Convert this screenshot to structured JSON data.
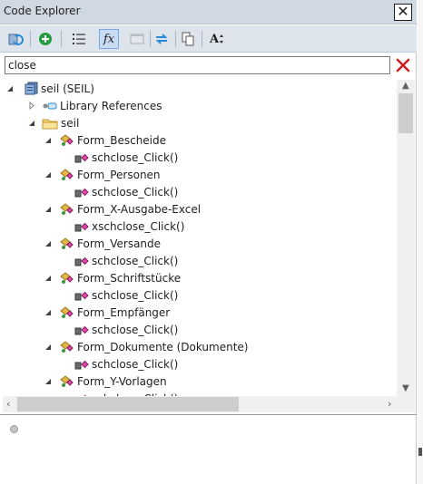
{
  "window": {
    "title": "Code Explorer",
    "close_glyph": "✕"
  },
  "toolbar": {
    "buttons": [
      {
        "name": "refresh-icon"
      },
      {
        "name": "add-icon"
      },
      {
        "name": "numbered-list-icon"
      },
      {
        "name": "function-icon",
        "label": "fx",
        "active": true
      },
      {
        "name": "window-icon",
        "disabled": true
      },
      {
        "name": "sync-icon"
      },
      {
        "name": "copy-icon"
      },
      {
        "name": "sort-icon",
        "label": "A"
      }
    ]
  },
  "search": {
    "value": "close",
    "clear_icon": "clear-search-icon"
  },
  "tree": {
    "root": "seil (SEIL)",
    "library_references": "Library References",
    "folder": "seil",
    "forms": [
      {
        "name": "Form_Bescheide",
        "member": "schclose_Click()"
      },
      {
        "name": "Form_Personen",
        "member": "schclose_Click()"
      },
      {
        "name": "Form_X-Ausgabe-Excel",
        "member": "xschclose_Click()"
      },
      {
        "name": "Form_Versande",
        "member": "schclose_Click()"
      },
      {
        "name": "Form_Schriftstücke",
        "member": "schclose_Click()"
      },
      {
        "name": "Form_Empfänger",
        "member": "schclose_Click()"
      },
      {
        "name": "Form_Dokumente (Dokumente)",
        "member": "schclose_Click()"
      },
      {
        "name": "Form_Y-Vorlagen",
        "member": "schclose_Click()"
      }
    ]
  },
  "colors": {
    "accent": "#2a8dd4",
    "title_bar": "#cfd8e3",
    "toolbar": "#dde4ec",
    "clear": "#d02020"
  }
}
